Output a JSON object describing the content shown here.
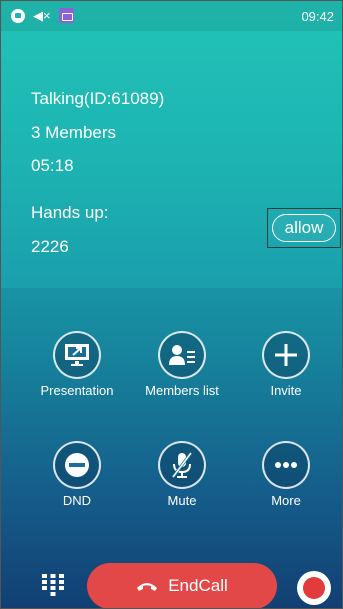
{
  "status": {
    "time": "09:42",
    "icons": [
      "lock-icon",
      "mute-speaker-icon",
      "calendar-icon"
    ]
  },
  "call": {
    "state": "Talking(ID:61089)",
    "members": "3 Members",
    "duration": "05:18"
  },
  "hands_up": {
    "label": "Hands up:",
    "id": "2226",
    "allow_label": "allow"
  },
  "actions": [
    {
      "label": "Presentation",
      "icon": "presentation-icon"
    },
    {
      "label": "Members list",
      "icon": "members-list-icon"
    },
    {
      "label": "Invite",
      "icon": "plus-icon"
    },
    {
      "label": "DND",
      "icon": "dnd-icon"
    },
    {
      "label": "Mute",
      "icon": "mute-microphone-icon"
    },
    {
      "label": "More",
      "icon": "more-icon"
    }
  ],
  "bottom": {
    "end_call_label": "EndCall"
  },
  "colors": {
    "end_call": "#e24848",
    "record": "#e23b3b"
  }
}
